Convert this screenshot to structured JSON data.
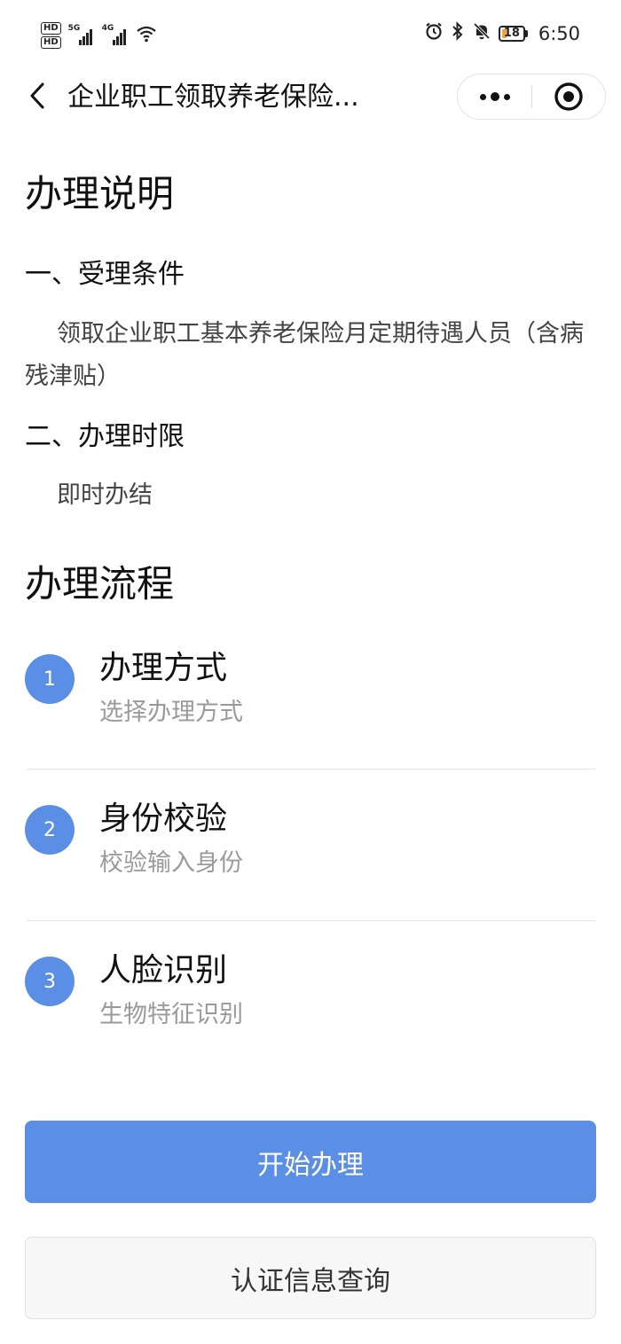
{
  "status_bar": {
    "hd1": "HD",
    "hd2": "HD",
    "signal1_label": "5G",
    "signal2_label": "4G",
    "battery": "18",
    "time": "6:50",
    "icons": [
      "alarm-icon",
      "bluetooth-icon",
      "mute-bell-icon",
      "wifi-icon"
    ]
  },
  "nav": {
    "title": "企业职工领取养老保险...",
    "icons": [
      "back-chevron-icon",
      "more-dots-icon",
      "close-target-icon"
    ]
  },
  "instructions": {
    "heading": "办理说明",
    "section1_title": "一、受理条件",
    "section1_body": "领取企业职工基本养老保险月定期待遇人员（含病残津贴）",
    "section2_title": "二、办理时限",
    "section2_body": "即时办结"
  },
  "process": {
    "heading": "办理流程",
    "steps": [
      {
        "num": "1",
        "title": "办理方式",
        "subtitle": "选择办理方式"
      },
      {
        "num": "2",
        "title": "身份校验",
        "subtitle": "校验输入身份"
      },
      {
        "num": "3",
        "title": "人脸识别",
        "subtitle": "生物特征识别"
      }
    ]
  },
  "actions": {
    "start_label": "开始办理",
    "query_label": "认证信息查询"
  },
  "colors": {
    "accent": "#5b8fe6",
    "secondary_bg": "#f7f7f7",
    "subtitle_text": "#9a9a9a"
  }
}
